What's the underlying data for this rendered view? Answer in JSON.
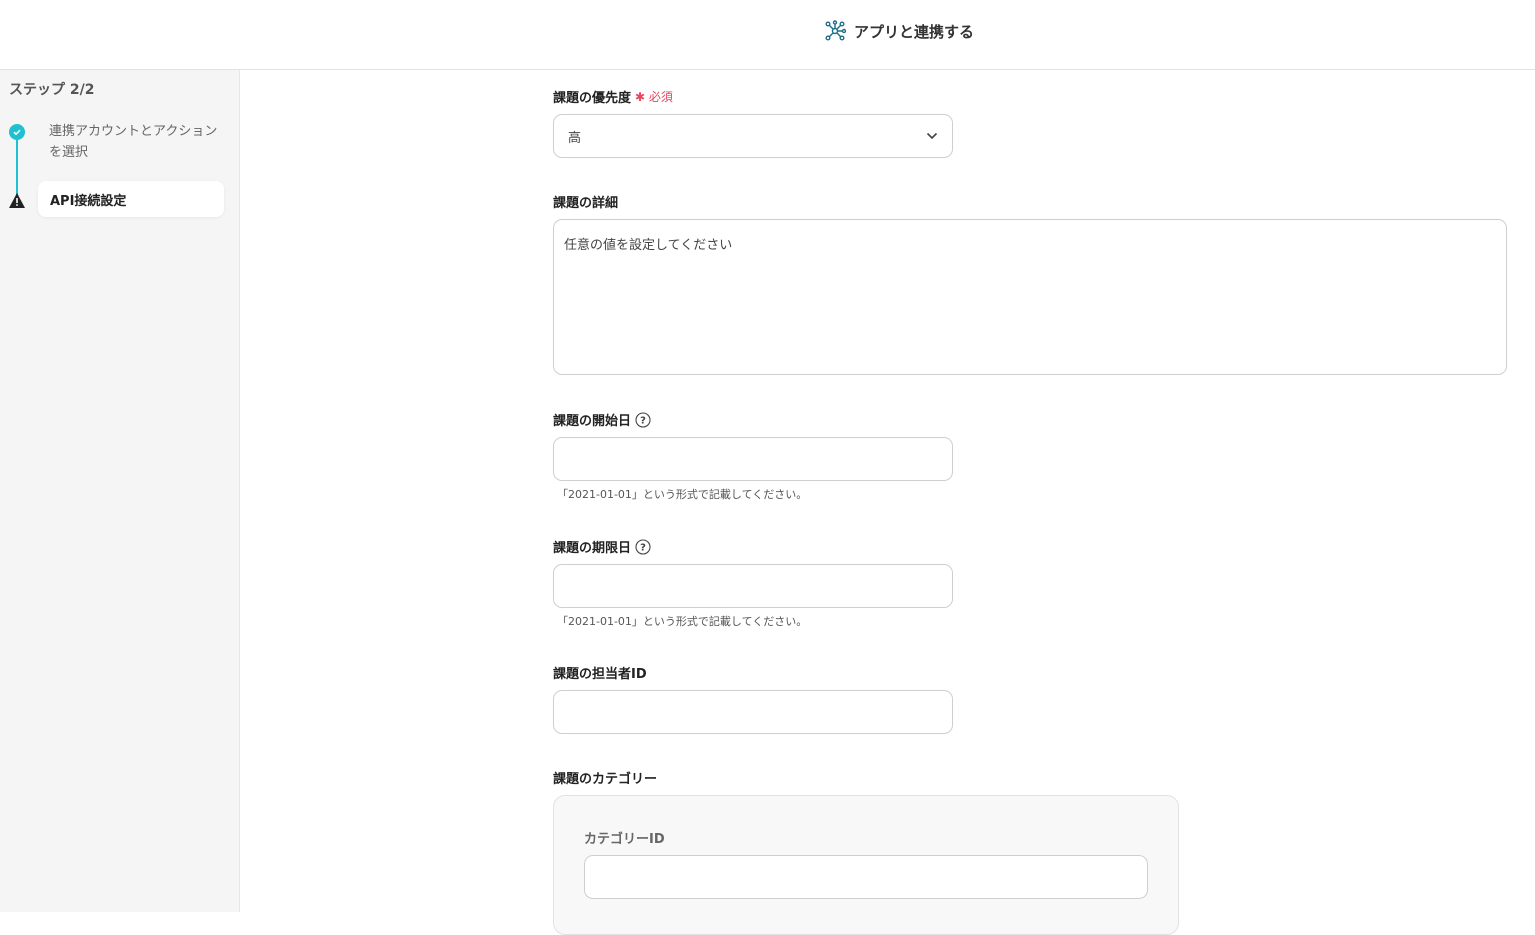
{
  "header": {
    "title": "アプリと連携する",
    "icon": "network-icon",
    "icon_color": "#1b6f8a"
  },
  "sidebar": {
    "step": "ステップ 2/2",
    "steps": [
      {
        "label": "連携アカウントとアクションを選択",
        "status": "done"
      },
      {
        "label": "API接続設定",
        "status": "warning"
      }
    ],
    "accent": "#1ec1cf"
  },
  "form": {
    "priority": {
      "label": "課題の優先度",
      "required": "必須",
      "value": "高"
    },
    "detail": {
      "label": "課題の詳細",
      "placeholder": "任意の値を設定してください"
    },
    "start": {
      "label": "課題の開始日",
      "hint": "「2021-01-01」という形式で記載してください。",
      "value": ""
    },
    "due": {
      "label": "課題の期限日",
      "hint": "「2021-01-01」という形式で記載してください。",
      "value": ""
    },
    "assignee": {
      "label": "課題の担当者ID",
      "value": ""
    },
    "category": {
      "label": "課題のカテゴリー",
      "sub_label": "カテゴリーID",
      "value": ""
    }
  }
}
